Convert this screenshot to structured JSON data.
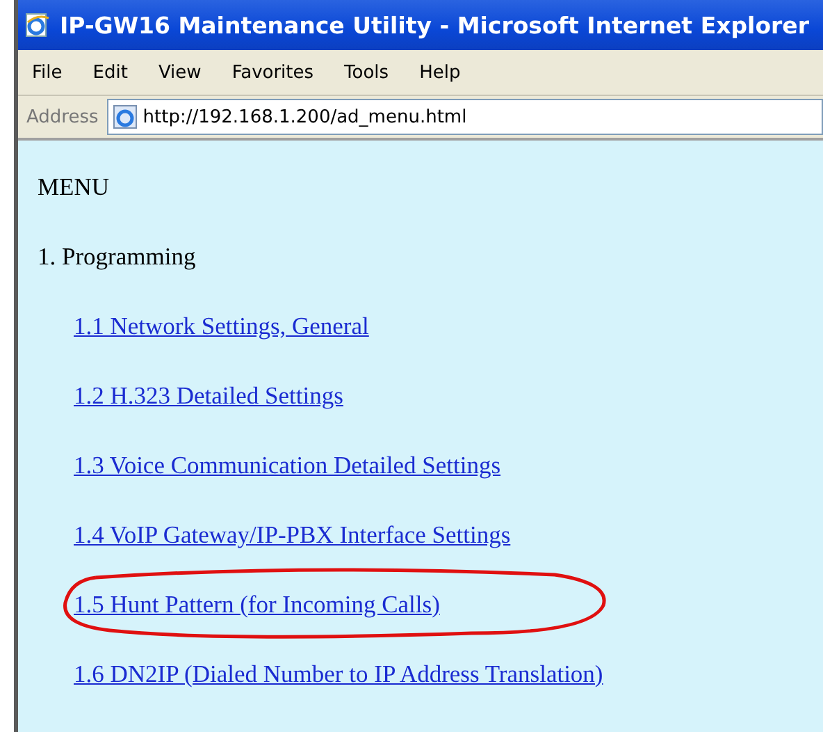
{
  "window": {
    "title": "IP-GW16 Maintenance Utility - Microsoft Internet Explorer"
  },
  "menu_bar": [
    "File",
    "Edit",
    "View",
    "Favorites",
    "Tools",
    "Help"
  ],
  "address_bar": {
    "label": "Address",
    "value": "http://192.168.1.200/ad_menu.html"
  },
  "page": {
    "heading": "MENU",
    "section": "1. Programming",
    "links": [
      {
        "label": "1.1 Network Settings, General",
        "circled": false
      },
      {
        "label": "1.2 H.323 Detailed Settings",
        "circled": false
      },
      {
        "label": "1.3 Voice Communication Detailed Settings",
        "circled": false
      },
      {
        "label": "1.4 VoIP Gateway/IP-PBX Interface Settings",
        "circled": false
      },
      {
        "label": "1.5 Hunt Pattern (for Incoming Calls)",
        "circled": true
      },
      {
        "label": "1.6 DN2IP (Dialed Number to IP Address Translation)",
        "circled": false
      }
    ]
  }
}
